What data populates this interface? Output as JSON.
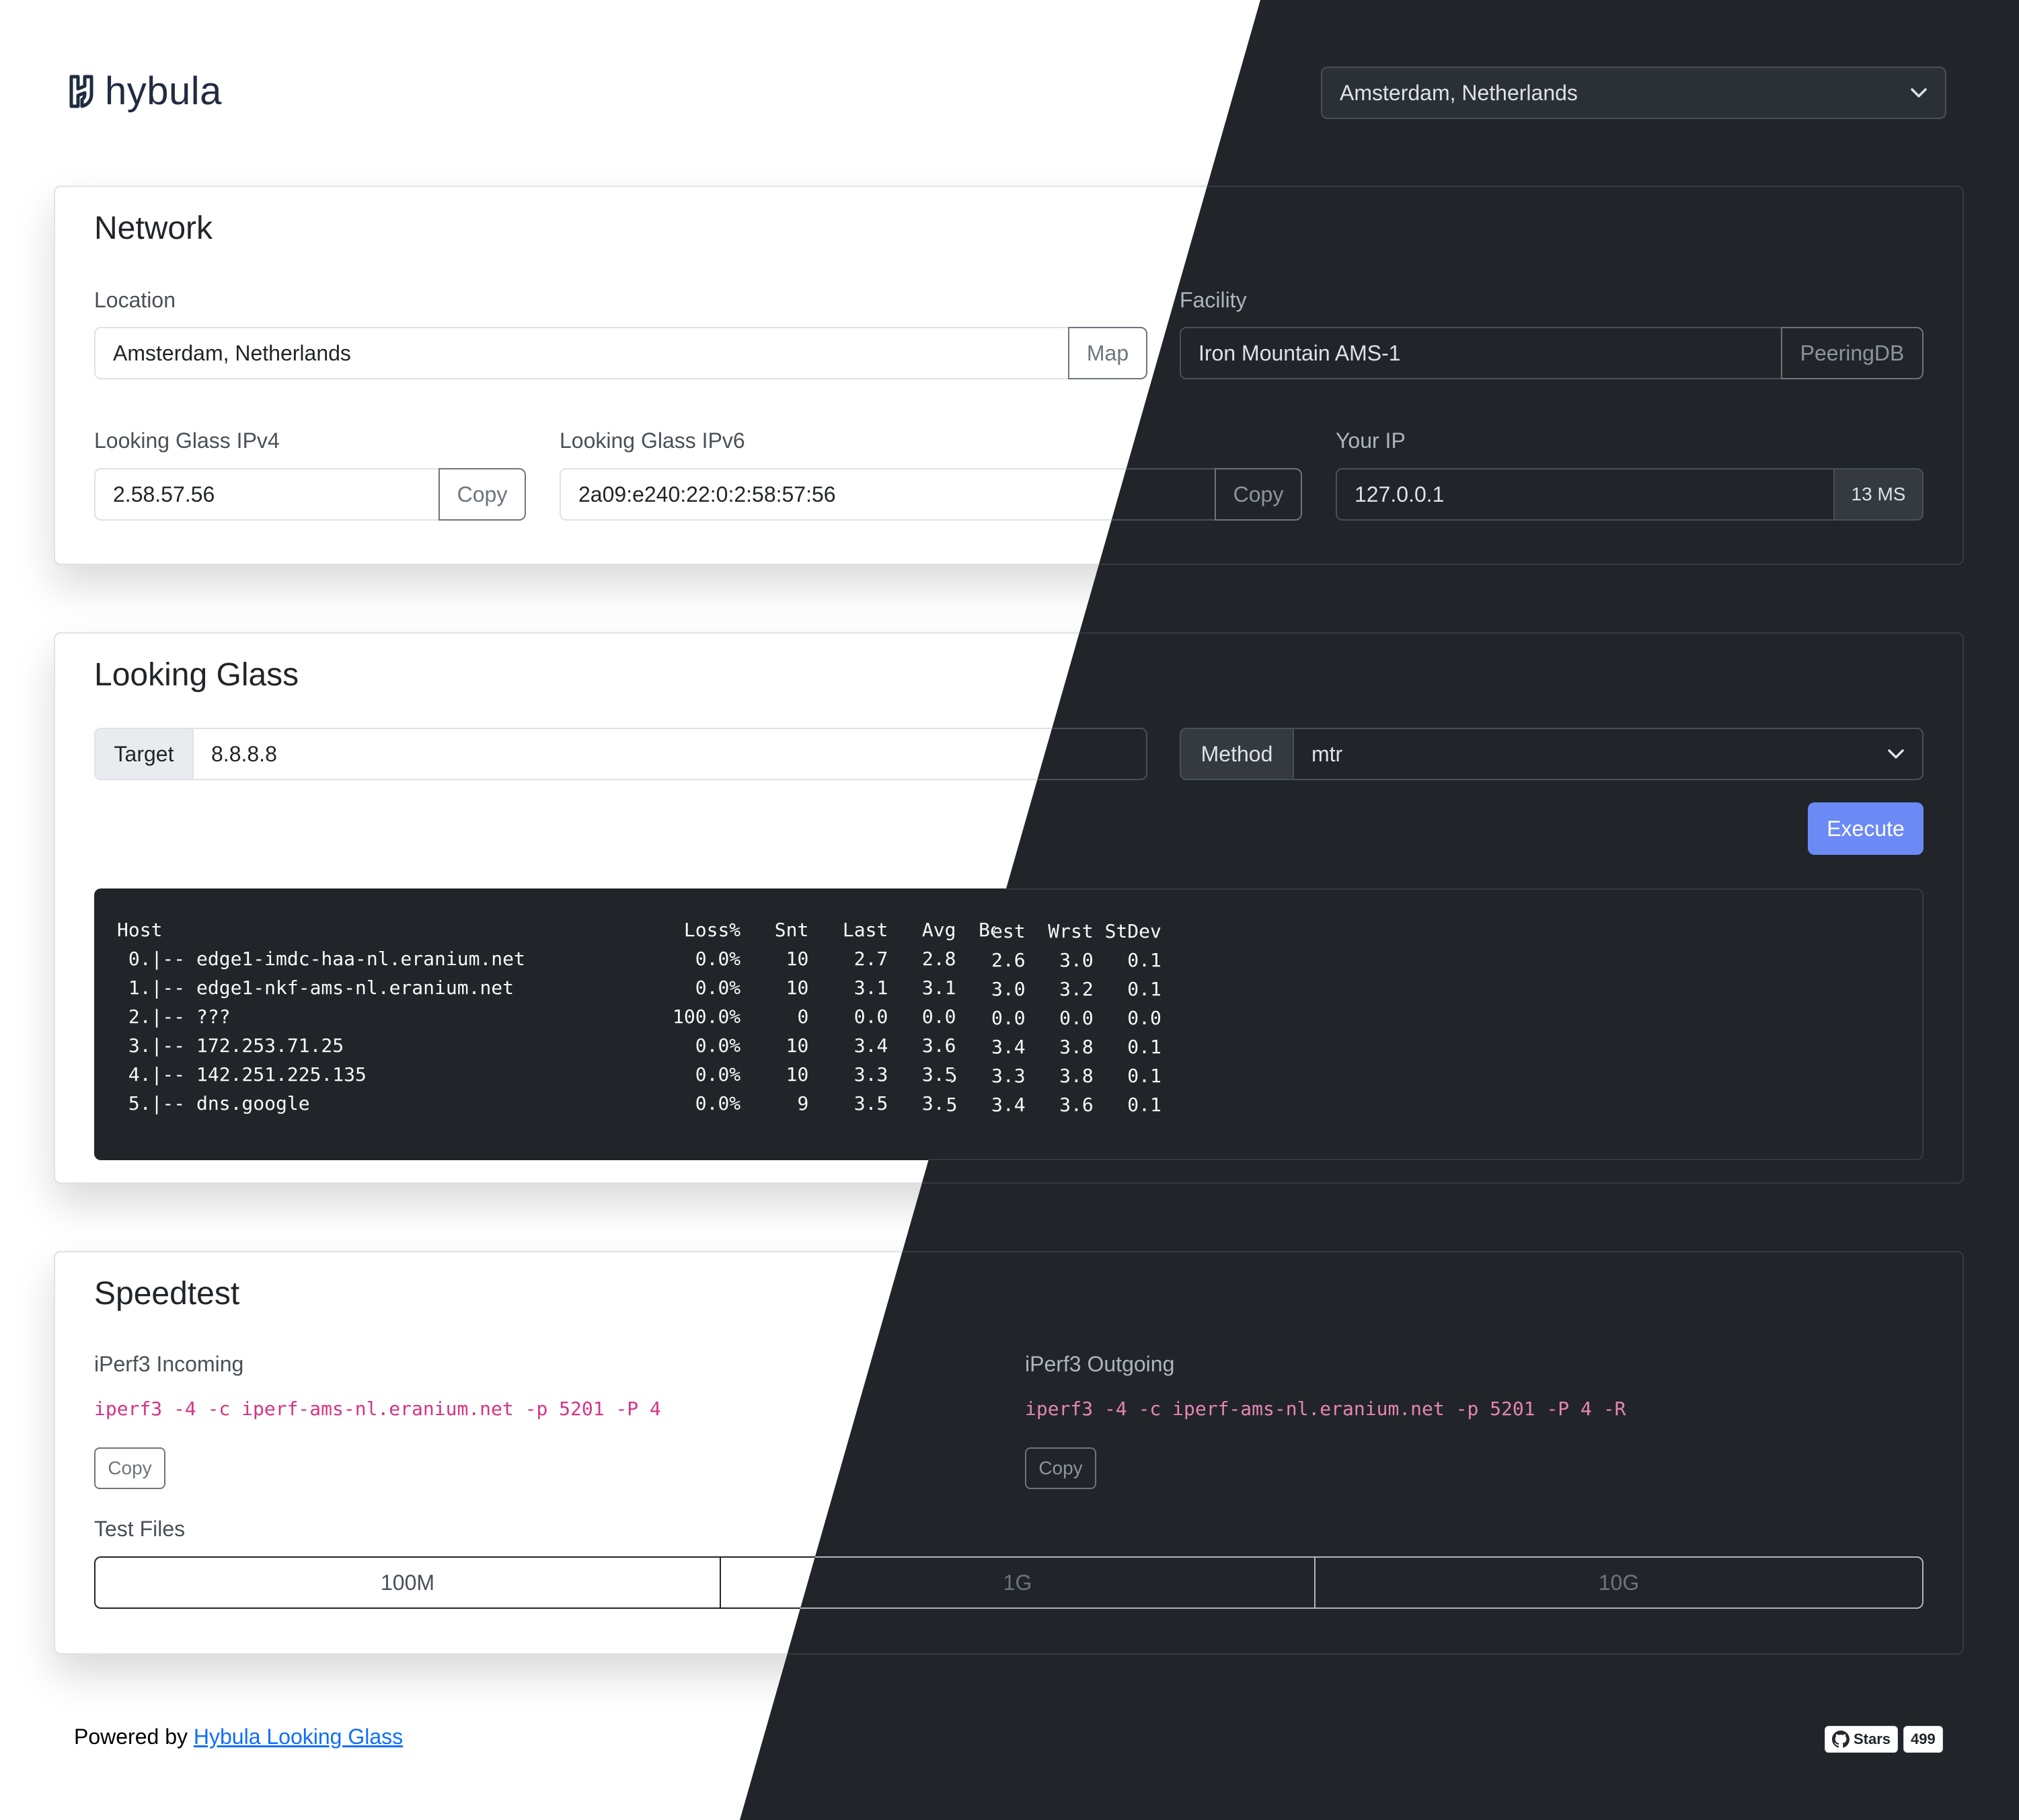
{
  "brand": {
    "name": "hybula"
  },
  "location_select": {
    "value": "Amsterdam, Netherlands"
  },
  "network": {
    "title": "Network",
    "location_label": "Location",
    "location_value": "Amsterdam, Netherlands",
    "map_button": "Map",
    "facility_label": "Facility",
    "facility_value": "Iron Mountain AMS-1",
    "peeringdb_button": "PeeringDB",
    "ipv4_label": "Looking Glass IPv4",
    "ipv4_value": "2.58.57.56",
    "ipv4_copy": "Copy",
    "ipv6_label": "Looking Glass IPv6",
    "ipv6_value": "2a09:e240:22:0:2:58:57:56",
    "ipv6_copy": "Copy",
    "your_ip_label": "Your IP",
    "your_ip_value": "127.0.0.1",
    "latency": "13 MS"
  },
  "looking_glass": {
    "title": "Looking Glass",
    "target_label": "Target",
    "target_value": "8.8.8.8",
    "method_label": "Method",
    "method_value": "mtr",
    "execute_button": "Execute",
    "output": "Host                                              Loss%   Snt   Last   Avg  Best  Wrst StDev\n 0.|-- edge1-imdc-haa-nl.eranium.net               0.0%    10    2.7   2.8   2.6   3.0   0.1\n 1.|-- edge1-nkf-ams-nl.eranium.net                0.0%    10    3.1   3.1   3.0   3.2   0.1\n 2.|-- ???                                       100.0%     0    0.0   0.0   0.0   0.0   0.0\n 3.|-- 172.253.71.25                               0.0%    10    3.4   3.6   3.4   3.8   0.1\n 4.|-- 142.251.225.135                             0.0%    10    3.3   3.5   3.3   3.8   0.1\n 5.|-- dns.google                                  0.0%     9    3.5   3.5   3.4   3.6   0.1"
  },
  "speedtest": {
    "title": "Speedtest",
    "incoming_label": "iPerf3 Incoming",
    "incoming_cmd": "iperf3 -4 -c iperf-ams-nl.eranium.net -p 5201 -P 4",
    "incoming_copy": "Copy",
    "outgoing_label": "iPerf3 Outgoing",
    "outgoing_cmd": "iperf3 -4 -c iperf-ams-nl.eranium.net -p 5201 -P 4 -R",
    "outgoing_copy": "Copy",
    "test_files_label": "Test Files",
    "files": [
      "100M",
      "1G",
      "10G"
    ]
  },
  "footer": {
    "powered_by": "Powered by ",
    "link_text": "Hybula Looking Glass",
    "github_stars_label": "Stars",
    "github_stars_count": "499"
  },
  "icons": [
    "hybula-logo-icon",
    "chevron-down-icon",
    "github-icon"
  ]
}
